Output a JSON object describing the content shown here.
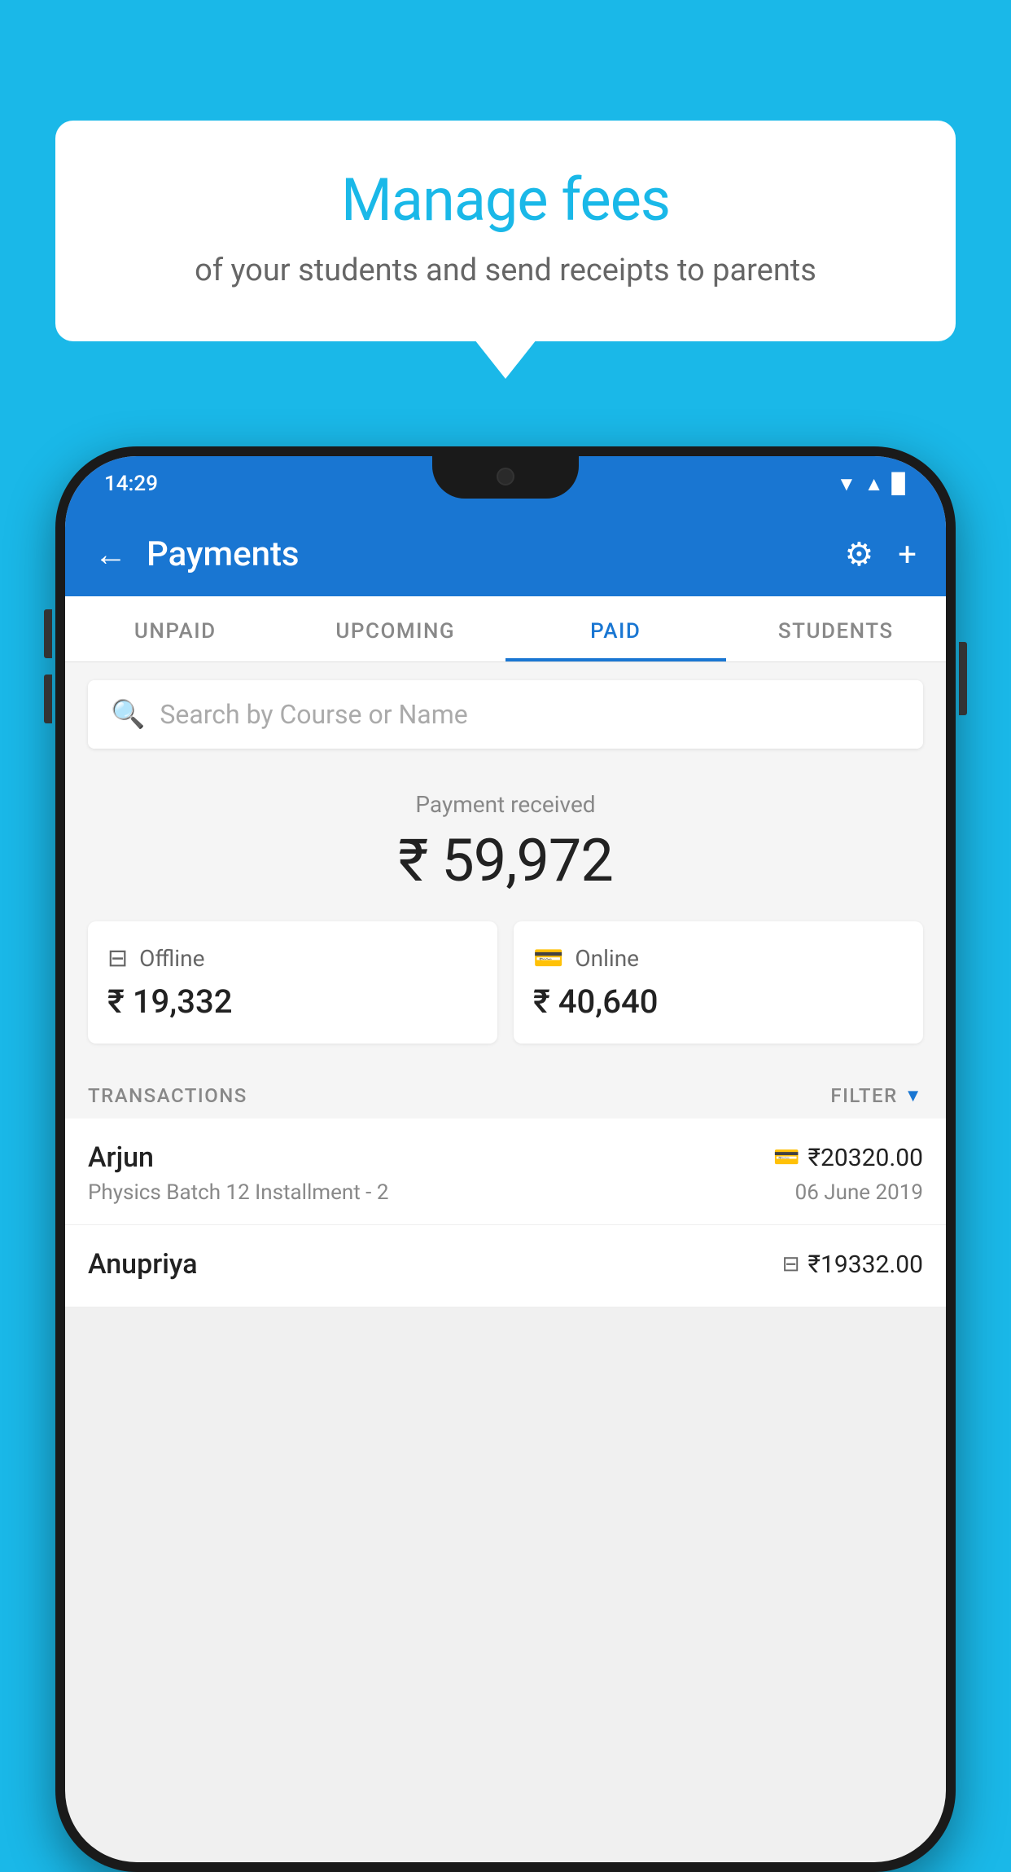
{
  "background_color": "#1ab8e8",
  "bubble": {
    "title": "Manage fees",
    "subtitle": "of your students and send receipts to parents"
  },
  "status_bar": {
    "time": "14:29",
    "wifi": "▲",
    "signal": "▲",
    "battery": "▉"
  },
  "header": {
    "title": "Payments",
    "back_label": "←",
    "gear_label": "⚙",
    "plus_label": "+"
  },
  "tabs": [
    {
      "label": "UNPAID",
      "active": false
    },
    {
      "label": "UPCOMING",
      "active": false
    },
    {
      "label": "PAID",
      "active": true
    },
    {
      "label": "STUDENTS",
      "active": false
    }
  ],
  "search": {
    "placeholder": "Search by Course or Name"
  },
  "payment_summary": {
    "label": "Payment received",
    "amount": "₹ 59,972"
  },
  "payment_cards": [
    {
      "icon": "offline",
      "label": "Offline",
      "amount": "₹ 19,332"
    },
    {
      "icon": "online",
      "label": "Online",
      "amount": "₹ 40,640"
    }
  ],
  "transactions_section": {
    "label": "TRANSACTIONS",
    "filter_label": "FILTER"
  },
  "transactions": [
    {
      "name": "Arjun",
      "course": "Physics Batch 12 Installment - 2",
      "amount": "₹20320.00",
      "date": "06 June 2019",
      "payment_type": "card"
    },
    {
      "name": "Anupriya",
      "course": "",
      "amount": "₹19332.00",
      "date": "",
      "payment_type": "offline"
    }
  ]
}
